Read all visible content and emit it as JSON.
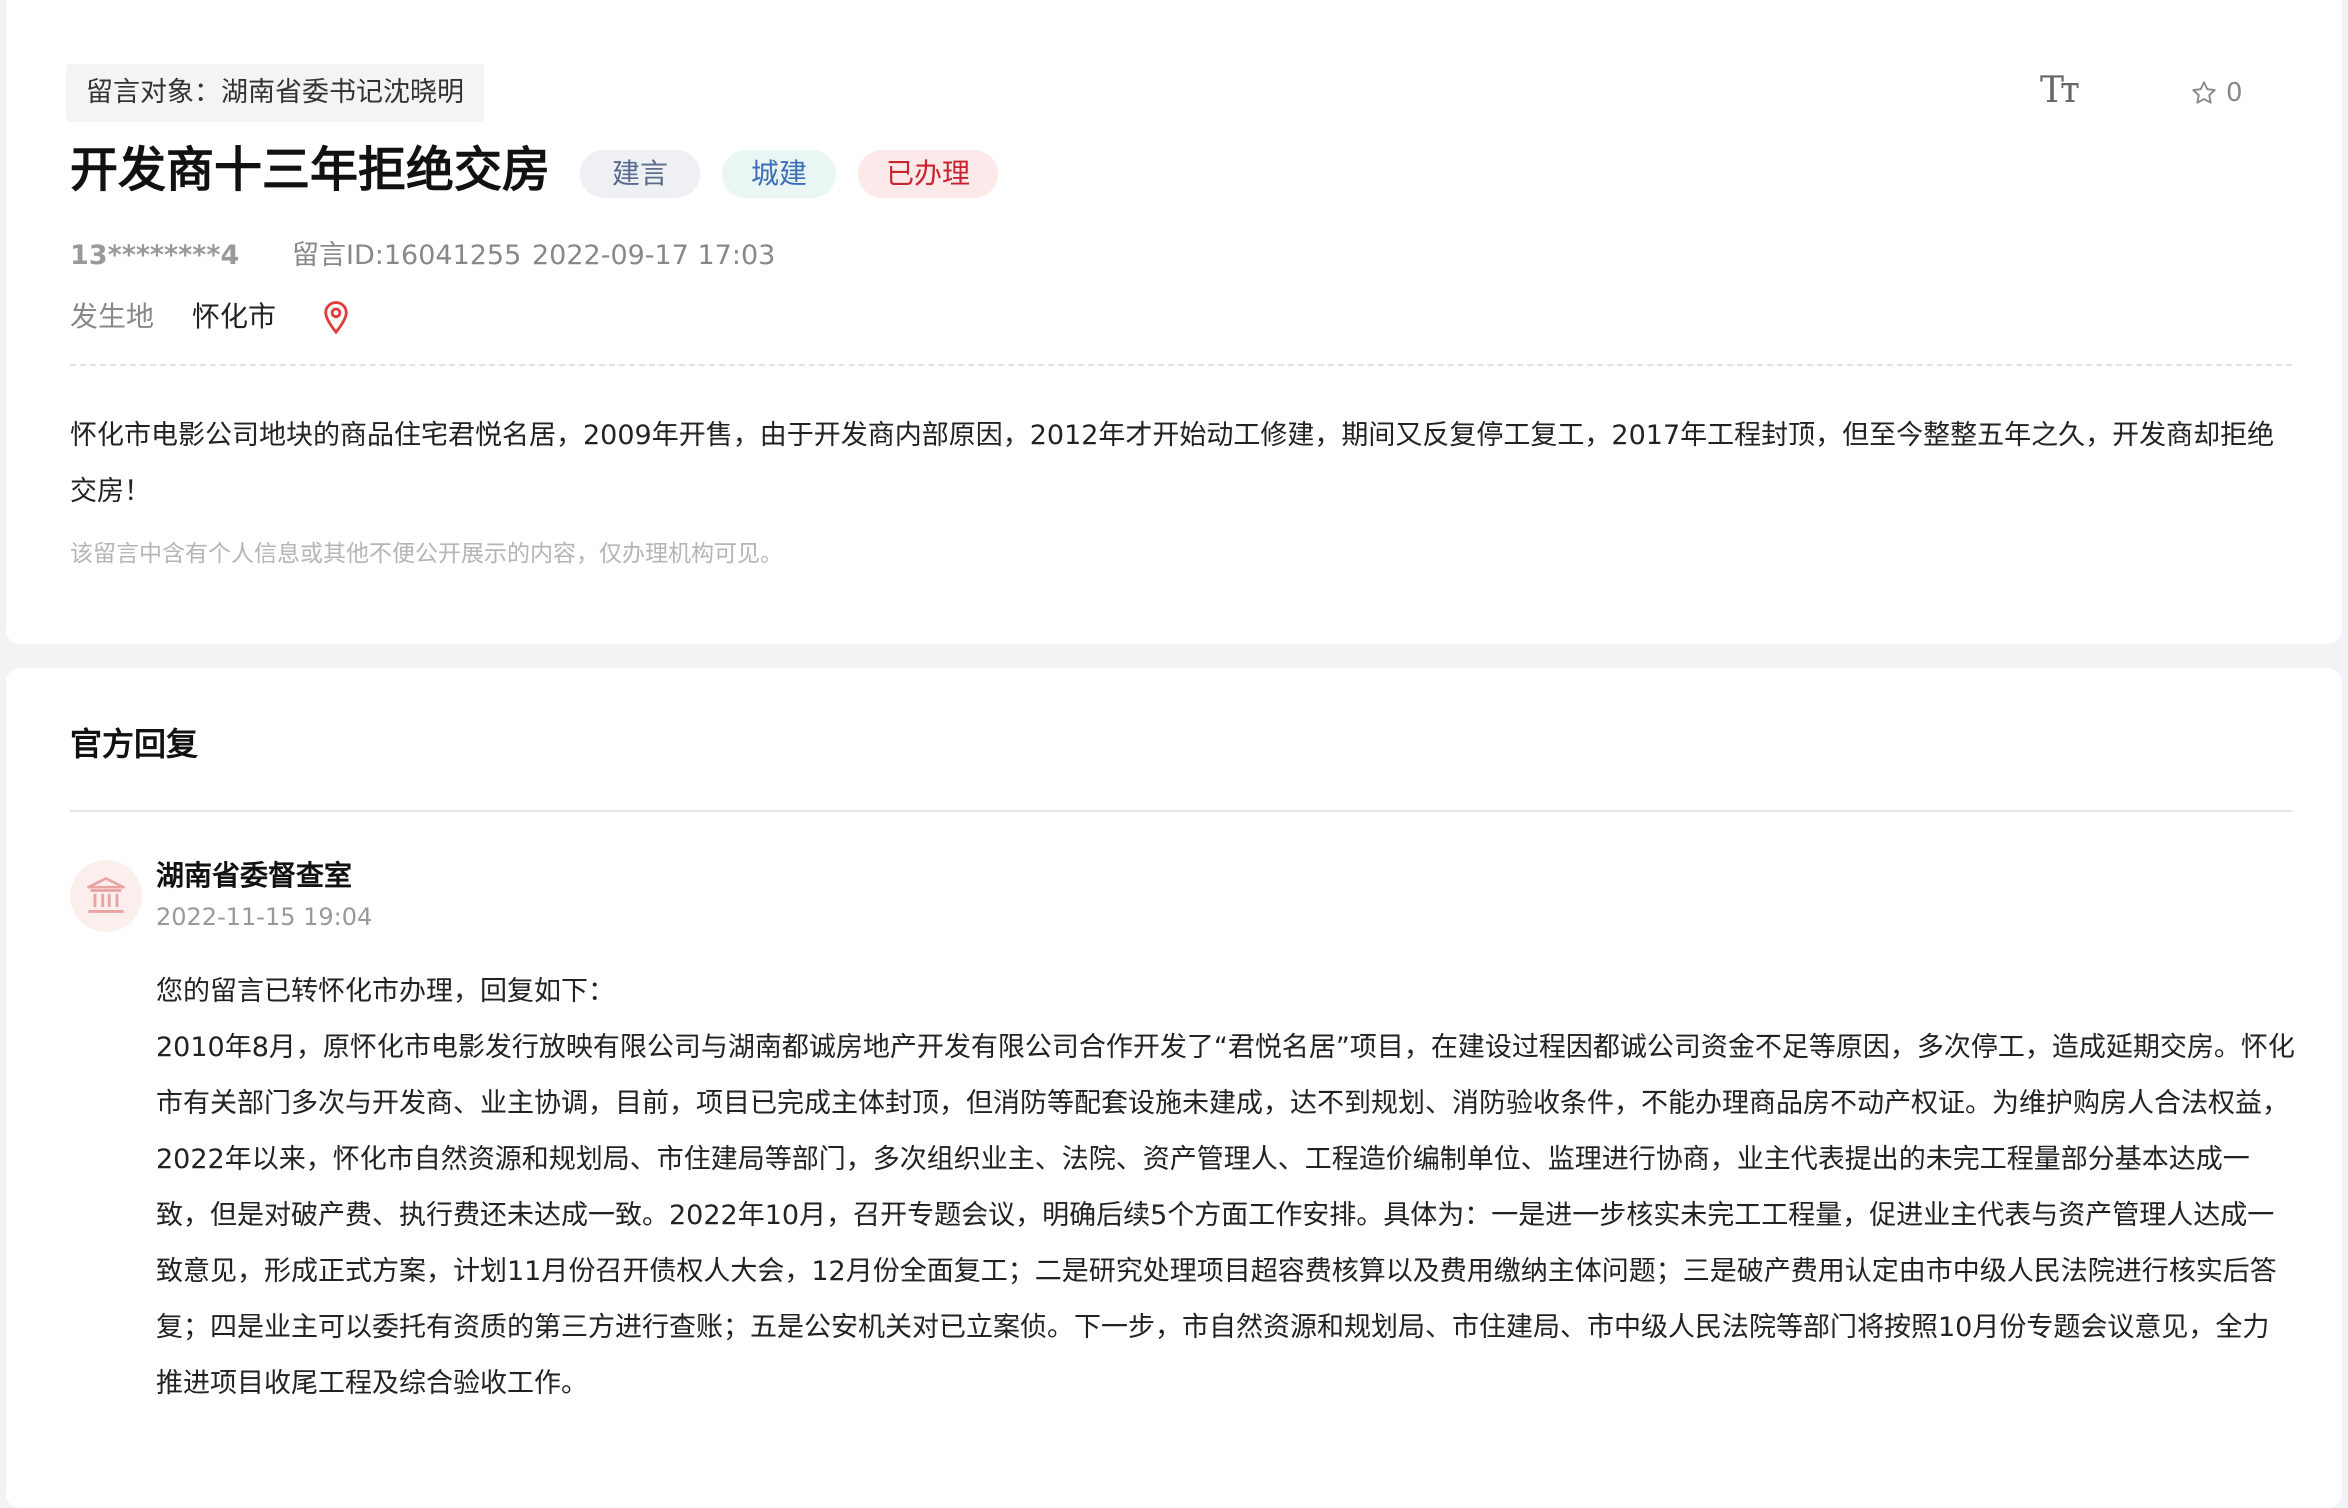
{
  "message": {
    "target": "留言对象：湖南省委书记沈晓明",
    "title": "开发商十三年拒绝交房",
    "tags": [
      "建言",
      "城建",
      "已办理"
    ],
    "user": "13********4",
    "id_text": "留言ID:16041255",
    "time": "2022-09-17 17:03",
    "location_label": "发生地",
    "location": "怀化市",
    "content": "怀化市电影公司地块的商品住宅君悦名居，2009年开售，由于开发商内部原因，2012年才开始动工修建，期间又反复停工复工，2017年工程封顶，但至今整整五年之久，开发商却拒绝交房！",
    "notice": "该留言中含有个人信息或其他不便公开展示的内容，仅办理机构可见。"
  },
  "toolbar": {
    "font_size_icon": "Tт",
    "favorite_count": "0"
  },
  "reply": {
    "heading": "官方回复",
    "org": "湖南省委督查室",
    "time": "2022-11-15 19:04",
    "intro": "您的留言已转怀化市办理，回复如下：",
    "body": "2010年8月，原怀化市电影发行放映有限公司与湖南都诚房地产开发有限公司合作开发了“君悦名居”项目，在建设过程因都诚公司资金不足等原因，多次停工，造成延期交房。怀化市有关部门多次与开发商、业主协调，目前，项目已完成主体封顶，但消防等配套设施未建成，达不到规划、消防验收条件，不能办理商品房不动产权证。为维护购房人合法权益，2022年以来，怀化市自然资源和规划局、市住建局等部门，多次组织业主、法院、资产管理人、工程造价编制单位、监理进行协商，业主代表提出的未完工程量部分基本达成一致，但是对破产费、执行费还未达成一致。2022年10月，召开专题会议，明确后续5个方面工作安排。具体为：一是进一步核实未完工工程量，促进业主代表与资产管理人达成一致意见，形成正式方案，计划11月份召开债权人大会，12月份全面复工；二是研究处理项目超容费核算以及费用缴纳主体问题；三是破产费用认定由市中级人民法院进行核实后答复；四是业主可以委托有资质的第三方进行查账；五是公安机关对已立案侦。下一步，市自然资源和规划局、市住建局、市中级人民法院等部门将按照10月份专题会议意见，全力推进项目收尾工程及综合验收工作。"
  },
  "colors": {
    "tag_advice_bg": "#eef0f4",
    "tag_advice_text": "#5a6b8c",
    "tag_city_bg": "#e9f6f4",
    "tag_city_text": "#3d6fb8",
    "tag_done_bg": "#fde9ea",
    "tag_done_text": "#c8262e",
    "location_pin": "#e03c3c",
    "avatar_bg": "#fdeeee"
  },
  "icons": {
    "location": "location-pin-icon",
    "favorite": "star-outline-icon",
    "font_size": "font-size-icon",
    "org": "government-building-icon"
  }
}
